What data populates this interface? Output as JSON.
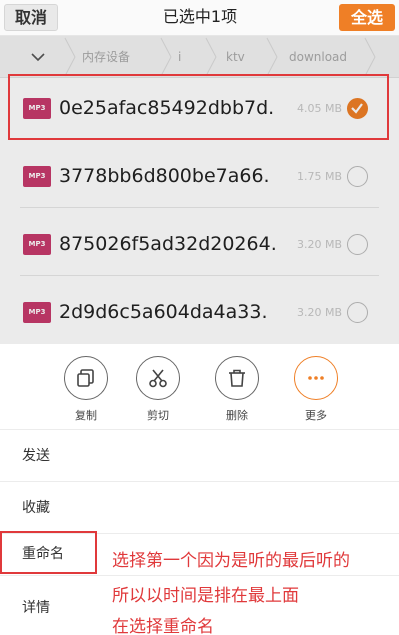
{
  "header": {
    "cancel_label": "取消",
    "title": "已选中1项",
    "select_all_label": "全选"
  },
  "breadcrumb": {
    "items": [
      "内存设备",
      "i",
      "ktv",
      "download"
    ]
  },
  "files": [
    {
      "badge": "MP3",
      "name": "0e25afac85492dbb7d.",
      "size": "4.05 MB",
      "checked": true
    },
    {
      "badge": "MP3",
      "name": "3778bb6d800be7a66.",
      "size": "1.75 MB",
      "checked": false
    },
    {
      "badge": "MP3",
      "name": "875026f5ad32d20264.",
      "size": "3.20 MB",
      "checked": false
    },
    {
      "badge": "MP3",
      "name": "2d9d6c5a604da4a33.",
      "size": "3.20 MB",
      "checked": false
    }
  ],
  "actions": {
    "copy_label": "复制",
    "cut_label": "剪切",
    "delete_label": "删除",
    "more_label": "更多"
  },
  "menu": {
    "send": "发送",
    "favorite": "收藏",
    "rename": "重命名",
    "details": "详情"
  },
  "annotation": {
    "line1": "选择第一个因为是听的最后听的",
    "line2": "所以以时间是排在最上面",
    "line3": "在选择重命名"
  },
  "colors": {
    "accent": "#ef7f26",
    "mp3_badge": "#c73a6c",
    "annotation_red": "#e0393b"
  },
  "icons": [
    "chevron-down-icon",
    "check-icon",
    "copy-icon",
    "scissors-icon",
    "trash-icon",
    "more-icon"
  ]
}
